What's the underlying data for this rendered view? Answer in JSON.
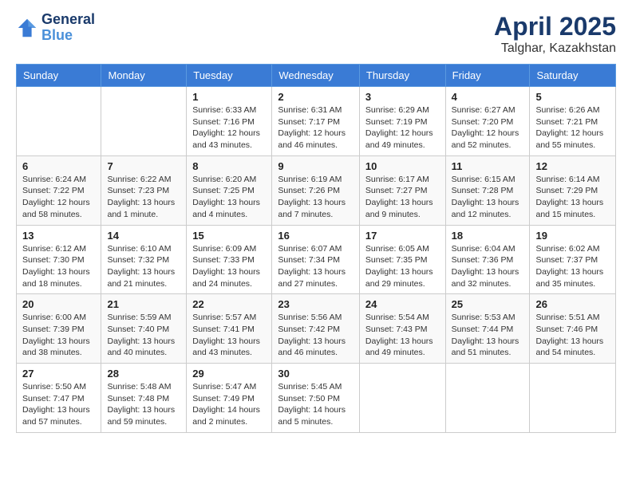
{
  "header": {
    "logo_line1": "General",
    "logo_line2": "Blue",
    "month_title": "April 2025",
    "location": "Talghar, Kazakhstan"
  },
  "weekdays": [
    "Sunday",
    "Monday",
    "Tuesday",
    "Wednesday",
    "Thursday",
    "Friday",
    "Saturday"
  ],
  "weeks": [
    [
      {
        "day": "",
        "info": ""
      },
      {
        "day": "",
        "info": ""
      },
      {
        "day": "1",
        "info": "Sunrise: 6:33 AM\nSunset: 7:16 PM\nDaylight: 12 hours and 43 minutes."
      },
      {
        "day": "2",
        "info": "Sunrise: 6:31 AM\nSunset: 7:17 PM\nDaylight: 12 hours and 46 minutes."
      },
      {
        "day": "3",
        "info": "Sunrise: 6:29 AM\nSunset: 7:19 PM\nDaylight: 12 hours and 49 minutes."
      },
      {
        "day": "4",
        "info": "Sunrise: 6:27 AM\nSunset: 7:20 PM\nDaylight: 12 hours and 52 minutes."
      },
      {
        "day": "5",
        "info": "Sunrise: 6:26 AM\nSunset: 7:21 PM\nDaylight: 12 hours and 55 minutes."
      }
    ],
    [
      {
        "day": "6",
        "info": "Sunrise: 6:24 AM\nSunset: 7:22 PM\nDaylight: 12 hours and 58 minutes."
      },
      {
        "day": "7",
        "info": "Sunrise: 6:22 AM\nSunset: 7:23 PM\nDaylight: 13 hours and 1 minute."
      },
      {
        "day": "8",
        "info": "Sunrise: 6:20 AM\nSunset: 7:25 PM\nDaylight: 13 hours and 4 minutes."
      },
      {
        "day": "9",
        "info": "Sunrise: 6:19 AM\nSunset: 7:26 PM\nDaylight: 13 hours and 7 minutes."
      },
      {
        "day": "10",
        "info": "Sunrise: 6:17 AM\nSunset: 7:27 PM\nDaylight: 13 hours and 9 minutes."
      },
      {
        "day": "11",
        "info": "Sunrise: 6:15 AM\nSunset: 7:28 PM\nDaylight: 13 hours and 12 minutes."
      },
      {
        "day": "12",
        "info": "Sunrise: 6:14 AM\nSunset: 7:29 PM\nDaylight: 13 hours and 15 minutes."
      }
    ],
    [
      {
        "day": "13",
        "info": "Sunrise: 6:12 AM\nSunset: 7:30 PM\nDaylight: 13 hours and 18 minutes."
      },
      {
        "day": "14",
        "info": "Sunrise: 6:10 AM\nSunset: 7:32 PM\nDaylight: 13 hours and 21 minutes."
      },
      {
        "day": "15",
        "info": "Sunrise: 6:09 AM\nSunset: 7:33 PM\nDaylight: 13 hours and 24 minutes."
      },
      {
        "day": "16",
        "info": "Sunrise: 6:07 AM\nSunset: 7:34 PM\nDaylight: 13 hours and 27 minutes."
      },
      {
        "day": "17",
        "info": "Sunrise: 6:05 AM\nSunset: 7:35 PM\nDaylight: 13 hours and 29 minutes."
      },
      {
        "day": "18",
        "info": "Sunrise: 6:04 AM\nSunset: 7:36 PM\nDaylight: 13 hours and 32 minutes."
      },
      {
        "day": "19",
        "info": "Sunrise: 6:02 AM\nSunset: 7:37 PM\nDaylight: 13 hours and 35 minutes."
      }
    ],
    [
      {
        "day": "20",
        "info": "Sunrise: 6:00 AM\nSunset: 7:39 PM\nDaylight: 13 hours and 38 minutes."
      },
      {
        "day": "21",
        "info": "Sunrise: 5:59 AM\nSunset: 7:40 PM\nDaylight: 13 hours and 40 minutes."
      },
      {
        "day": "22",
        "info": "Sunrise: 5:57 AM\nSunset: 7:41 PM\nDaylight: 13 hours and 43 minutes."
      },
      {
        "day": "23",
        "info": "Sunrise: 5:56 AM\nSunset: 7:42 PM\nDaylight: 13 hours and 46 minutes."
      },
      {
        "day": "24",
        "info": "Sunrise: 5:54 AM\nSunset: 7:43 PM\nDaylight: 13 hours and 49 minutes."
      },
      {
        "day": "25",
        "info": "Sunrise: 5:53 AM\nSunset: 7:44 PM\nDaylight: 13 hours and 51 minutes."
      },
      {
        "day": "26",
        "info": "Sunrise: 5:51 AM\nSunset: 7:46 PM\nDaylight: 13 hours and 54 minutes."
      }
    ],
    [
      {
        "day": "27",
        "info": "Sunrise: 5:50 AM\nSunset: 7:47 PM\nDaylight: 13 hours and 57 minutes."
      },
      {
        "day": "28",
        "info": "Sunrise: 5:48 AM\nSunset: 7:48 PM\nDaylight: 13 hours and 59 minutes."
      },
      {
        "day": "29",
        "info": "Sunrise: 5:47 AM\nSunset: 7:49 PM\nDaylight: 14 hours and 2 minutes."
      },
      {
        "day": "30",
        "info": "Sunrise: 5:45 AM\nSunset: 7:50 PM\nDaylight: 14 hours and 5 minutes."
      },
      {
        "day": "",
        "info": ""
      },
      {
        "day": "",
        "info": ""
      },
      {
        "day": "",
        "info": ""
      }
    ]
  ]
}
